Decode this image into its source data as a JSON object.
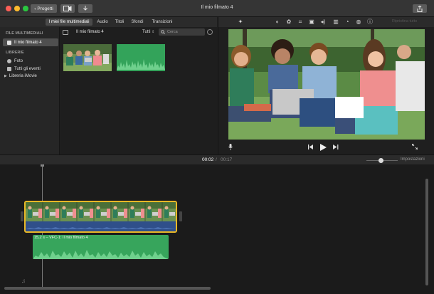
{
  "titlebar": {
    "back_label": "Progetti",
    "window_title": "Il mio filmato 4"
  },
  "tabs": [
    {
      "label": "I miei file multimediali"
    },
    {
      "label": "Audio"
    },
    {
      "label": "Titoli"
    },
    {
      "label": "Sfondi"
    },
    {
      "label": "Transizioni"
    }
  ],
  "sidebar": {
    "section_media": "FILE MULTIMEDIALI",
    "project_item": "Il mio filmato 4",
    "section_libraries": "LIBRERIE",
    "photos": "Foto",
    "all_events": "Tutti gli eventi",
    "library": "Libreria iMovie"
  },
  "browser": {
    "title": "Il mio filmato 4",
    "filter": "Tutti",
    "search_placeholder": "Cerca"
  },
  "viewer": {
    "reset_all": "Ripristina tutto"
  },
  "timeline": {
    "current_time": "00:02",
    "separator": "/",
    "total_time": "00:17",
    "settings_label": "Impostazioni",
    "audio_clip_label": "15,2 s – VFC-1: Il mio filmato 4"
  },
  "colors": {
    "accent_selection": "#e9b826",
    "audio_clip": "#37a55c",
    "video_clip_bg": "#2f4f8a"
  }
}
